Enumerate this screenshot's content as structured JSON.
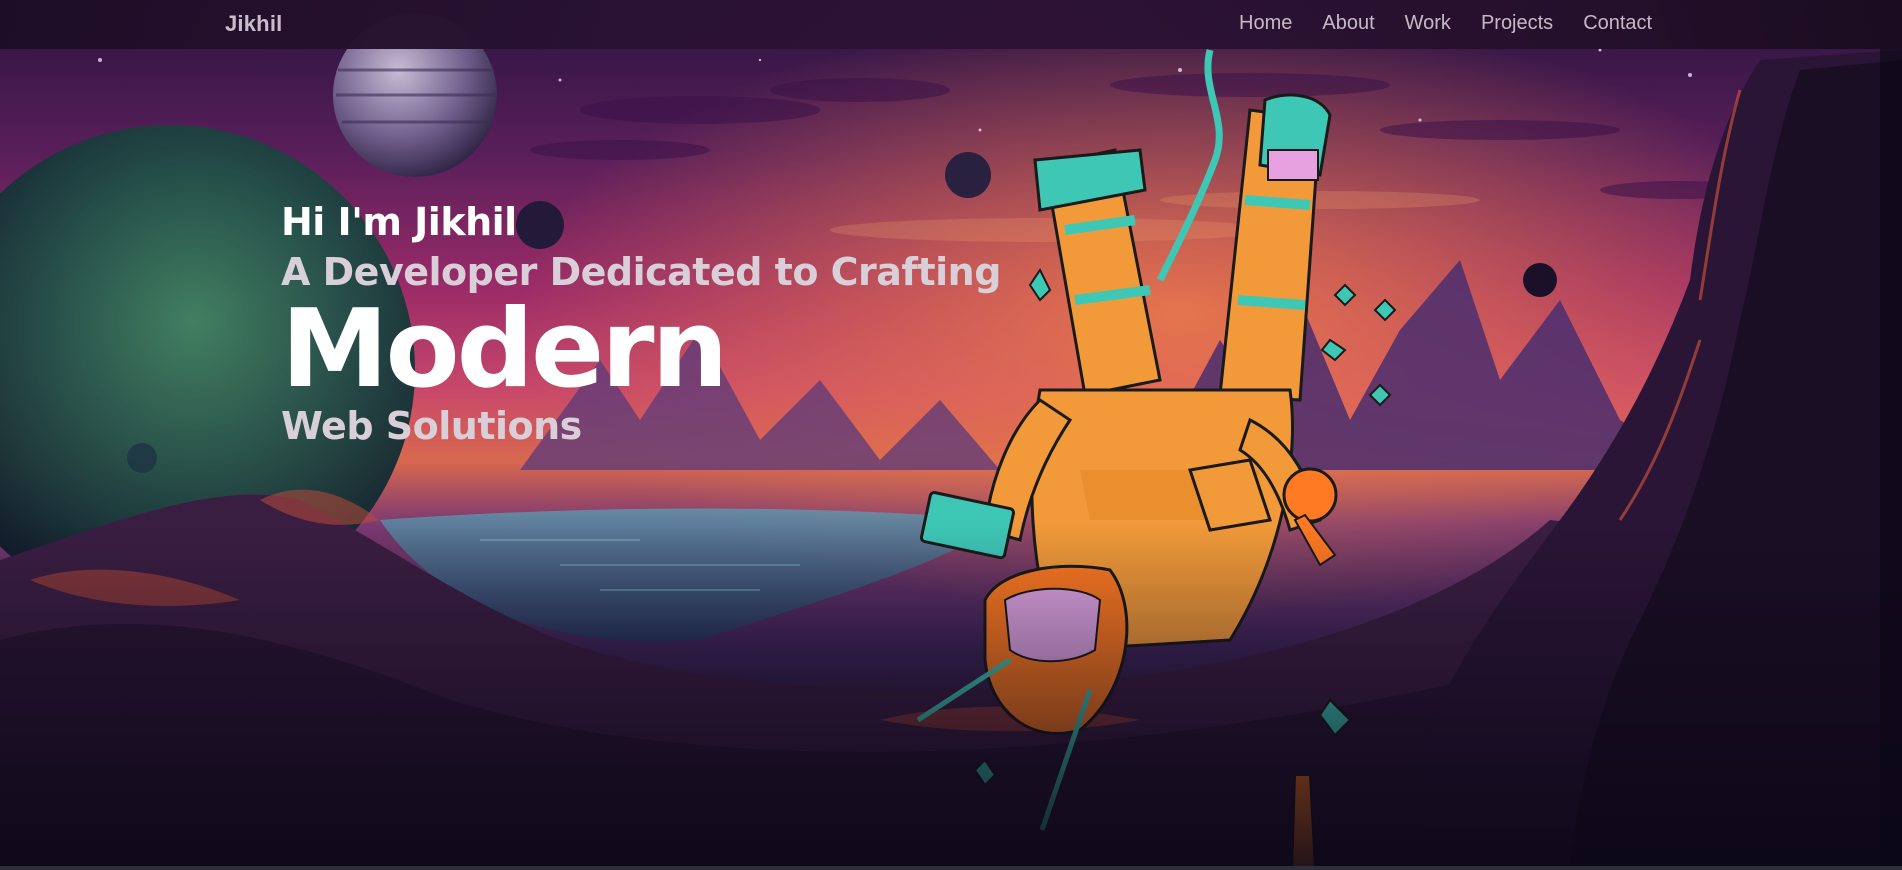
{
  "brand": {
    "name": "Jikhil"
  },
  "nav": {
    "items": [
      {
        "label": "Home"
      },
      {
        "label": "About"
      },
      {
        "label": "Work"
      },
      {
        "label": "Projects"
      },
      {
        "label": "Contact"
      }
    ]
  },
  "hero": {
    "greeting": "Hi I'm Jikhil",
    "tagline": "A Developer Dedicated to Crafting",
    "headline": "Modern",
    "subline": "Web Solutions"
  },
  "colors": {
    "sky_top": "#3a1a4d",
    "sky_mid": "#a12d6a",
    "horizon": "#e8743c",
    "suit_orange": "#f29a3a",
    "suit_teal": "#3fc7b6",
    "planet_green": "#2f8a66",
    "text_white": "#ffffff"
  },
  "icons": {
    "hero_illustration": "astronaut-floating-illustration"
  }
}
